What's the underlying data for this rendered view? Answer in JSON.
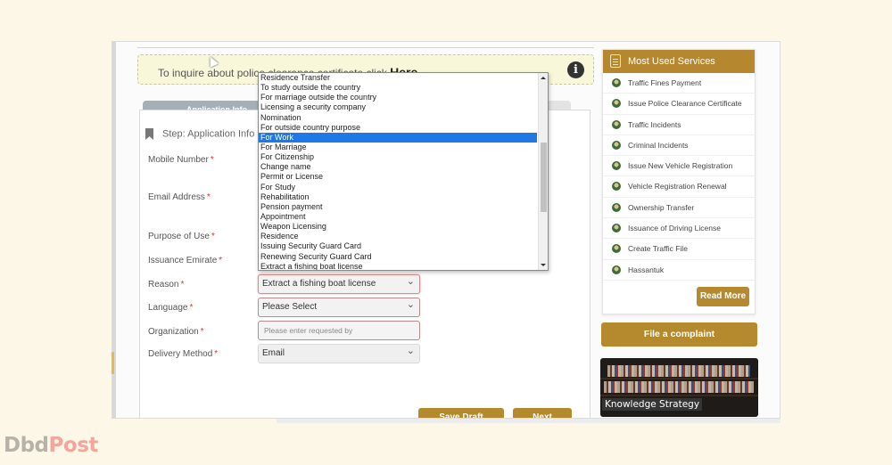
{
  "notice": {
    "text": "To inquire about police clearance certificate click ",
    "link": "Here"
  },
  "tabs": {
    "active": "Application Info"
  },
  "step": "Step: Application Info",
  "form": {
    "fields": [
      {
        "label": "Mobile Number",
        "required": "*"
      },
      {
        "label": "Email Address",
        "required": "*"
      },
      {
        "label": "Purpose of Use",
        "required": "*"
      },
      {
        "label": "Issuance Emirate",
        "required": "*"
      },
      {
        "label": "Reason",
        "required": "*",
        "value": "Extract a fishing boat license"
      },
      {
        "label": "Language",
        "required": "*",
        "value": "Please Select"
      },
      {
        "label": "Organization",
        "required": "*",
        "placeholder": "Please enter requested by"
      },
      {
        "label": "Delivery Method",
        "required": "*",
        "value": "Email"
      }
    ],
    "save_draft": "Save Draft",
    "next": "Next"
  },
  "dropdown": {
    "highlighted": "For Work",
    "options": [
      "Residence Transfer",
      "To study outside the country",
      "For marriage outside the country",
      "Licensing a security company",
      "Nomination",
      "For outside country purpose",
      "For Work",
      "For Marriage",
      "For Citizenship",
      "Change name",
      "Permit or License",
      "For Study",
      "Rehabilitation",
      "Pension payment",
      "Appointment",
      "Weapon Licensing",
      "Residence",
      "Issuing Security Guard Card",
      "Renewing Security Guard Card",
      "Extract a fishing boat license"
    ]
  },
  "sidebar": {
    "title": "Most Used Services",
    "items": [
      "Traffic Fines Payment",
      "Issue Police Clearance Certificate",
      "Traffic Incidents",
      "Criminal Incidents",
      "Issue New Vehicle Registration",
      "Vehicle Registration Renewal",
      "Ownership Transfer",
      "Issuance of Driving License",
      "Create Traffic File",
      "Hassantuk"
    ],
    "read_more": "Read More"
  },
  "complaint": "File a complaint",
  "knowledge": "Knowledge Strategy",
  "watermark": {
    "part1": "Dbd",
    "part2": "Post"
  },
  "colors": {
    "gold": "#b5882f",
    "highlight": "#1e78e6",
    "required": "#dd3333"
  }
}
